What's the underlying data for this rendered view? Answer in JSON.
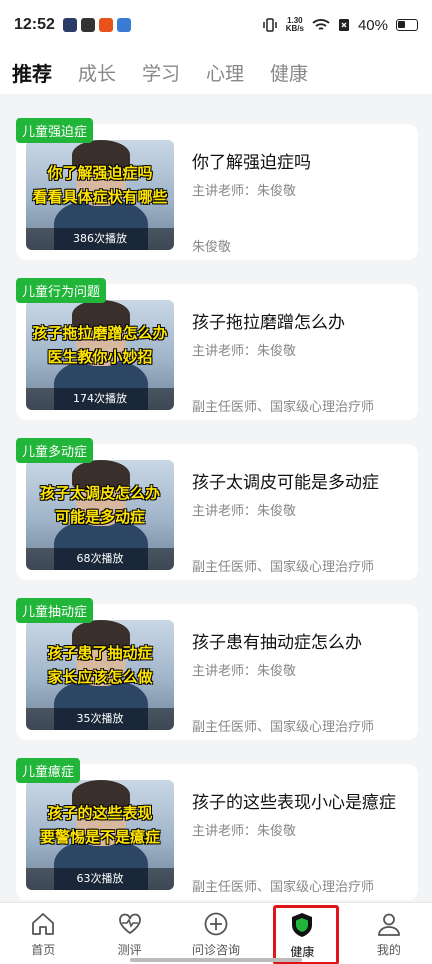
{
  "status": {
    "time": "12:52",
    "net_speed_top": "1.30",
    "net_speed_bottom": "KB/s",
    "battery": "40%"
  },
  "tabs": [
    {
      "label": "推荐",
      "active": true
    },
    {
      "label": "成长",
      "active": false
    },
    {
      "label": "学习",
      "active": false
    },
    {
      "label": "心理",
      "active": false
    },
    {
      "label": "健康",
      "active": false
    }
  ],
  "items": [
    {
      "tag": "儿童强迫症",
      "caption1": "你了解强迫症吗",
      "caption2": "看看具体症状有哪些",
      "plays": "386次播放",
      "title": "你了解强迫症吗",
      "teacher": "主讲老师：朱俊敬",
      "desc": "朱俊敬"
    },
    {
      "tag": "儿童行为问题",
      "caption1": "孩子拖拉磨蹭怎么办",
      "caption2": "医生教你小妙招",
      "plays": "174次播放",
      "title": "孩子拖拉磨蹭怎么办",
      "teacher": "主讲老师：朱俊敬",
      "desc": "副主任医师、国家级心理治疗师"
    },
    {
      "tag": "儿童多动症",
      "caption1": "孩子太调皮怎么办",
      "caption2": "可能是多动症",
      "plays": "68次播放",
      "title": "孩子太调皮可能是多动症",
      "teacher": "主讲老师：朱俊敬",
      "desc": "副主任医师、国家级心理治疗师"
    },
    {
      "tag": "儿童抽动症",
      "caption1": "孩子患了抽动症",
      "caption2": "家长应该怎么做",
      "plays": "35次播放",
      "title": "孩子患有抽动症怎么办",
      "teacher": "主讲老师：朱俊敬",
      "desc": "副主任医师、国家级心理治疗师"
    },
    {
      "tag": "儿童癔症",
      "caption1": "孩子的这些表现",
      "caption2": "要警惕是不是癔症",
      "plays": "63次播放",
      "title": "孩子的这些表现小心是癔症",
      "teacher": "主讲老师：朱俊敬",
      "desc": "副主任医师、国家级心理治疗师"
    }
  ],
  "tabbar": [
    {
      "label": "首页",
      "icon": "home-icon"
    },
    {
      "label": "测评",
      "icon": "heart-pulse-icon"
    },
    {
      "label": "问诊咨询",
      "icon": "plus-circle-icon"
    },
    {
      "label": "健康",
      "icon": "shield-icon"
    },
    {
      "label": "我的",
      "icon": "user-icon"
    }
  ],
  "colors": {
    "accent": "#21b53a",
    "highlight": "#e0141b"
  }
}
